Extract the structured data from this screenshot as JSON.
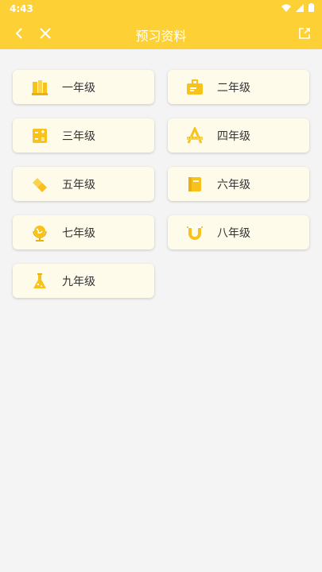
{
  "status_bar": {
    "time": "4:43"
  },
  "toolbar": {
    "title": "预习资料"
  },
  "grades": [
    {
      "label": "一年级",
      "icon": "book-stack-icon"
    },
    {
      "label": "二年级",
      "icon": "document-bag-icon"
    },
    {
      "label": "三年级",
      "icon": "calculator-icon"
    },
    {
      "label": "四年级",
      "icon": "letter-a-ruler-icon"
    },
    {
      "label": "五年级",
      "icon": "eraser-icon"
    },
    {
      "label": "六年级",
      "icon": "notebook-icon"
    },
    {
      "label": "七年级",
      "icon": "globe-icon"
    },
    {
      "label": "八年级",
      "icon": "magnet-icon"
    },
    {
      "label": "九年级",
      "icon": "flask-icon"
    }
  ],
  "colors": {
    "accent": "#fdd035",
    "card": "#fffbea",
    "icon": "#f7c21c"
  }
}
